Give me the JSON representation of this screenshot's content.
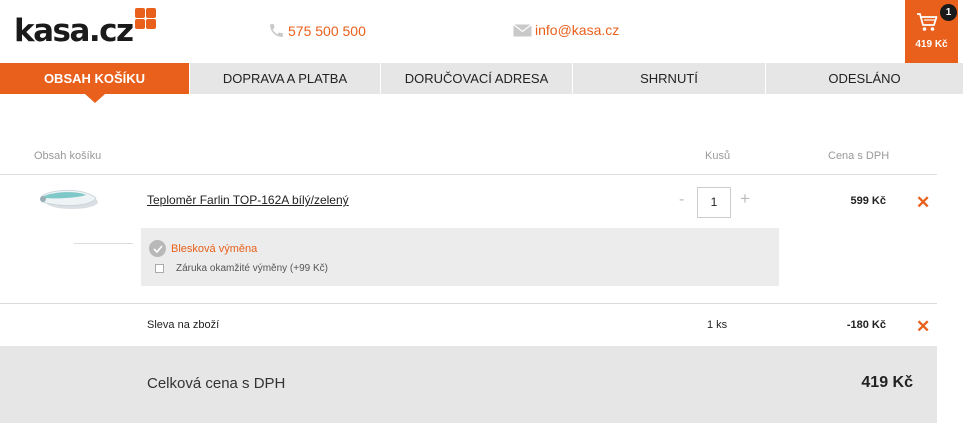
{
  "header": {
    "logo_text": "kasa.cz",
    "phone": "575 500 500",
    "email": "info@kasa.cz",
    "cart_count": "1",
    "cart_total": "419 Kč"
  },
  "steps": [
    {
      "label": "OBSAH KOŠÍKU",
      "active": true
    },
    {
      "label": "DOPRAVA A PLATBA",
      "active": false
    },
    {
      "label": "DORUČOVACÍ ADRESA",
      "active": false
    },
    {
      "label": "SHRNUTÍ",
      "active": false
    },
    {
      "label": "ODESLÁNO",
      "active": false
    }
  ],
  "table": {
    "col_content": "Obsah košíku",
    "col_qty": "Kusů",
    "col_price": "Cena s DPH"
  },
  "product": {
    "name": "Teploměr Farlin TOP-162A bílý/zelený",
    "qty_minus": "-",
    "qty": "1",
    "qty_plus": "+",
    "price": "599 Kč",
    "remove": "✕"
  },
  "service": {
    "title": "Blesková výměna",
    "option": "Záruka okamžité výměny (+99 Kč)"
  },
  "discount": {
    "label": "Sleva na zboží",
    "qty": "1 ks",
    "price": "-180 Kč",
    "remove": "✕"
  },
  "total": {
    "label": "Celková cena s DPH",
    "value": "419 Kč"
  },
  "colors": {
    "accent": "#e8601c",
    "step_bg": "#e6e6e6",
    "total_bg": "#e6e6e6",
    "service_bg": "#ececec"
  },
  "icons": {
    "phone": "phone-icon",
    "email": "envelope-icon",
    "cart": "cart-icon",
    "remove": "close-icon",
    "service": "check-badge-icon"
  }
}
